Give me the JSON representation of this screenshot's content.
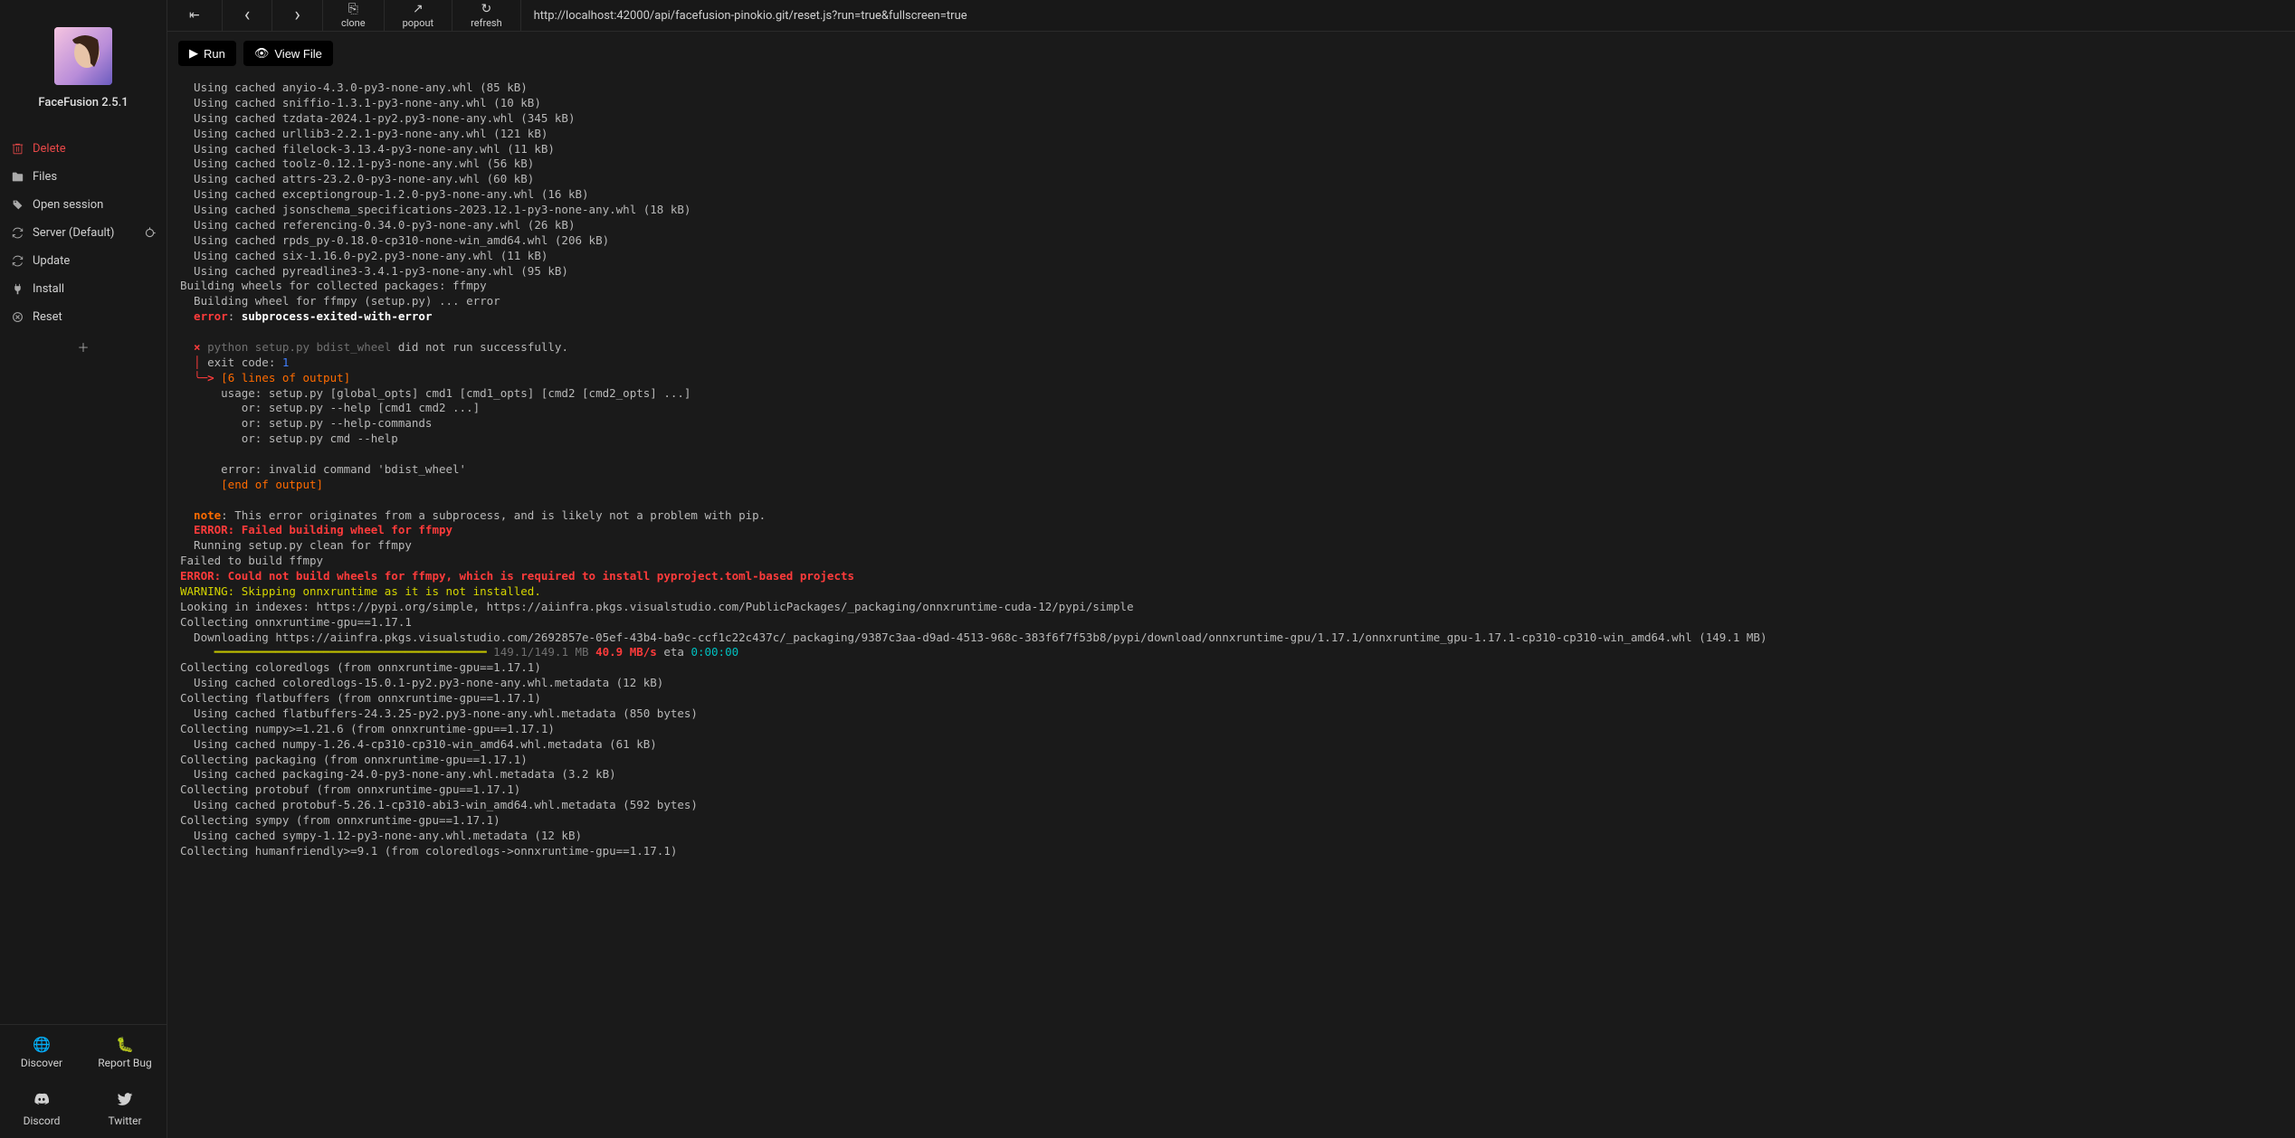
{
  "app": {
    "title": "FaceFusion 2.5.1"
  },
  "sidebar": {
    "items": [
      {
        "label": "Delete",
        "icon": "trash"
      },
      {
        "label": "Files",
        "icon": "folder"
      },
      {
        "label": "Open session",
        "icon": "tag"
      },
      {
        "label": "Server (Default)",
        "icon": "sync",
        "trailing": "refresh"
      },
      {
        "label": "Update",
        "icon": "sync"
      },
      {
        "label": "Install",
        "icon": "plug"
      },
      {
        "label": "Reset",
        "icon": "x-circle"
      }
    ]
  },
  "bottom": {
    "items": [
      {
        "label": "Discover",
        "icon": "globe"
      },
      {
        "label": "Report Bug",
        "icon": "bug"
      },
      {
        "label": "Discord",
        "icon": "discord"
      },
      {
        "label": "Twitter",
        "icon": "twitter"
      }
    ]
  },
  "toolbar": {
    "back_exit": "⇤",
    "back": "‹",
    "forward": "›",
    "clone": {
      "label": "clone",
      "icon": "⎘"
    },
    "popout": {
      "label": "popout",
      "icon": "↗"
    },
    "refresh": {
      "label": "refresh",
      "icon": "↻"
    },
    "url": "http://localhost:42000/api/facefusion-pinokio.git/reset.js?run=true&fullscreen=true"
  },
  "actions": {
    "run": "Run",
    "viewfile": "View File"
  },
  "terminal": {
    "cached": [
      "  Using cached anyio-4.3.0-py3-none-any.whl (85 kB)",
      "  Using cached sniffio-1.3.1-py3-none-any.whl (10 kB)",
      "  Using cached tzdata-2024.1-py2.py3-none-any.whl (345 kB)",
      "  Using cached urllib3-2.2.1-py3-none-any.whl (121 kB)",
      "  Using cached filelock-3.13.4-py3-none-any.whl (11 kB)",
      "  Using cached toolz-0.12.1-py3-none-any.whl (56 kB)",
      "  Using cached attrs-23.2.0-py3-none-any.whl (60 kB)",
      "  Using cached exceptiongroup-1.2.0-py3-none-any.whl (16 kB)",
      "  Using cached jsonschema_specifications-2023.12.1-py3-none-any.whl (18 kB)",
      "  Using cached referencing-0.34.0-py3-none-any.whl (26 kB)",
      "  Using cached rpds_py-0.18.0-cp310-none-win_amd64.whl (206 kB)",
      "  Using cached six-1.16.0-py2.py3-none-any.whl (11 kB)",
      "  Using cached pyreadline3-3.4.1-py3-none-any.whl (95 kB)"
    ],
    "build_wheels": "Building wheels for collected packages: ffmpy",
    "build_wheel_line": "  Building wheel for ffmpy (setup.py) ... error",
    "error_label": "  error",
    "error_msg": "subprocess-exited-with-error",
    "x": "  ×",
    "py_cmd": "python setup.py bdist_wheel",
    "py_tail": " did not run successfully.",
    "pipe": "  │",
    "exit_code_label": " exit code: ",
    "exit_code": "1",
    "arrow": "  ╰─>",
    "six_lines": " [6 lines of output]",
    "usage": [
      "      usage: setup.py [global_opts] cmd1 [cmd1_opts] [cmd2 [cmd2_opts] ...]",
      "         or: setup.py --help [cmd1 cmd2 ...]",
      "         or: setup.py --help-commands",
      "         or: setup.py cmd --help",
      "",
      "      error: invalid command 'bdist_wheel'"
    ],
    "end_output": "      [end of output]",
    "note_label": "  note",
    "note_msg": ": This error originates from a subprocess, and is likely not a problem with pip.",
    "err_fail_wheel": "  ERROR: Failed building wheel for ffmpy",
    "run_clean": "  Running setup.py clean for ffmpy",
    "fail_build": "Failed to build ffmpy",
    "err_could_not": "ERROR: Could not build wheels for ffmpy, which is required to install pyproject.toml-based projects",
    "warn_skip": "WARNING: Skipping onnxruntime as it is not installed.",
    "looking": "Looking in indexes: https://pypi.org/simple, https://aiinfra.pkgs.visualstudio.com/PublicPackages/_packaging/onnxruntime-cuda-12/pypi/simple",
    "collect_onnx": "Collecting onnxruntime-gpu==1.17.1",
    "download_onnx": "  Downloading https://aiinfra.pkgs.visualstudio.com/2692857e-05ef-43b4-ba9c-ccf1c22c437c/_packaging/9387c3aa-d9ad-4513-968c-383f6f7f53b8/pypi/download/onnxruntime-gpu/1.17.1/onnxruntime_gpu-1.17.1-cp310-cp310-win_amd64.whl (149.1 MB)",
    "bar": "     ━━━━━━━━━━━━━━━━━━━━━━━━━━━━━━━━━━━━━━━━",
    "bar_size": " 149.1/149.1 MB",
    "bar_speed": " 40.9 MB/s",
    "bar_eta_lbl": " eta ",
    "bar_eta": "0:00:00",
    "rest": [
      "Collecting coloredlogs (from onnxruntime-gpu==1.17.1)",
      "  Using cached coloredlogs-15.0.1-py2.py3-none-any.whl.metadata (12 kB)",
      "Collecting flatbuffers (from onnxruntime-gpu==1.17.1)",
      "  Using cached flatbuffers-24.3.25-py2.py3-none-any.whl.metadata (850 bytes)",
      "Collecting numpy>=1.21.6 (from onnxruntime-gpu==1.17.1)",
      "  Using cached numpy-1.26.4-cp310-cp310-win_amd64.whl.metadata (61 kB)",
      "Collecting packaging (from onnxruntime-gpu==1.17.1)",
      "  Using cached packaging-24.0-py3-none-any.whl.metadata (3.2 kB)",
      "Collecting protobuf (from onnxruntime-gpu==1.17.1)",
      "  Using cached protobuf-5.26.1-cp310-abi3-win_amd64.whl.metadata (592 bytes)",
      "Collecting sympy (from onnxruntime-gpu==1.17.1)",
      "  Using cached sympy-1.12-py3-none-any.whl.metadata (12 kB)",
      "Collecting humanfriendly>=9.1 (from coloredlogs->onnxruntime-gpu==1.17.1)"
    ]
  }
}
